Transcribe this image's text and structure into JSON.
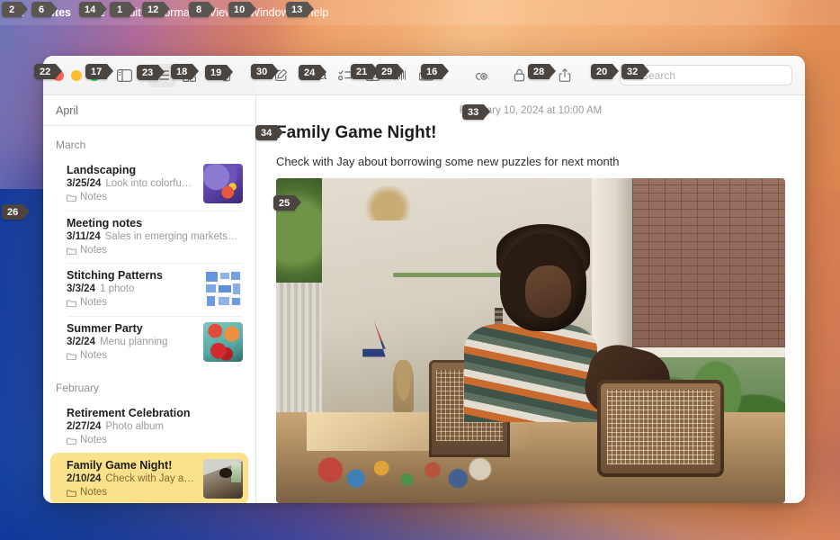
{
  "menubar": {
    "apple": "apple-logo",
    "items": [
      {
        "label": "Notes",
        "bold": true,
        "badge": "6"
      },
      {
        "label": "File",
        "bold": false,
        "badge": "14"
      },
      {
        "label": "Edit",
        "bold": false,
        "badge": "1"
      },
      {
        "label": "Format",
        "bold": false,
        "badge": "12"
      },
      {
        "label": "View",
        "bold": false,
        "badge": "8"
      },
      {
        "label": "Window",
        "bold": false,
        "badge": "10"
      },
      {
        "label": "Help",
        "bold": false,
        "badge": "13"
      }
    ],
    "apple_badge": "2"
  },
  "toolbar": {
    "traffic_badge": "22",
    "sidebar_toggle_badge": "17",
    "list_view_badge": "23",
    "gallery_view_badge": "18",
    "delete_badge": "19",
    "compose_badge": "30",
    "format_badge": "24",
    "format_label": "Aa",
    "checklist_badge": "21",
    "table_badge": "29",
    "link_badge": "16",
    "media_badge": "",
    "collaborate_badge": "28",
    "lock_badge": "",
    "share_badge": "20",
    "search_badge": "32"
  },
  "search": {
    "placeholder": "Search",
    "value": ""
  },
  "notelist": {
    "pinned_header": "April",
    "sections": [
      {
        "name": "March",
        "notes": [
          {
            "title": "Landscaping",
            "date": "3/25/24",
            "preview": "Look into colorfu…",
            "folder": "Notes",
            "thumb": "iris",
            "selected": false
          },
          {
            "title": "Meeting notes",
            "date": "3/11/24",
            "preview": "Sales in emerging markets…",
            "folder": "Notes",
            "thumb": "none",
            "selected": false
          },
          {
            "title": "Stitching Patterns",
            "date": "3/3/24",
            "preview": "1 photo",
            "folder": "Notes",
            "thumb": "stitch",
            "selected": false
          },
          {
            "title": "Summer Party",
            "date": "3/2/24",
            "preview": "Menu planning",
            "folder": "Notes",
            "thumb": "food",
            "selected": false
          }
        ]
      },
      {
        "name": "February",
        "notes": [
          {
            "title": "Retirement Celebration",
            "date": "2/27/24",
            "preview": "Photo album",
            "folder": "Notes",
            "thumb": "none",
            "selected": false
          },
          {
            "title": "Family Game Night!",
            "date": "2/10/24",
            "preview": "Check with Jay a…",
            "folder": "Notes",
            "thumb": "boy",
            "selected": true
          }
        ]
      }
    ]
  },
  "note": {
    "date": "February 10, 2024 at 10:00 AM",
    "date_badge": "33",
    "title": "Family Game Night!",
    "title_badge": "34",
    "body": "Check with Jay about borrowing some new puzzles for next month",
    "photo_badge": "25"
  },
  "desktop": {
    "badge": "26"
  },
  "colors": {
    "selected_note": "#fbe18a",
    "badge": "#5a5550",
    "traffic_red": "#ff5f57",
    "traffic_yellow": "#febc2e",
    "traffic_green": "#28c840"
  }
}
